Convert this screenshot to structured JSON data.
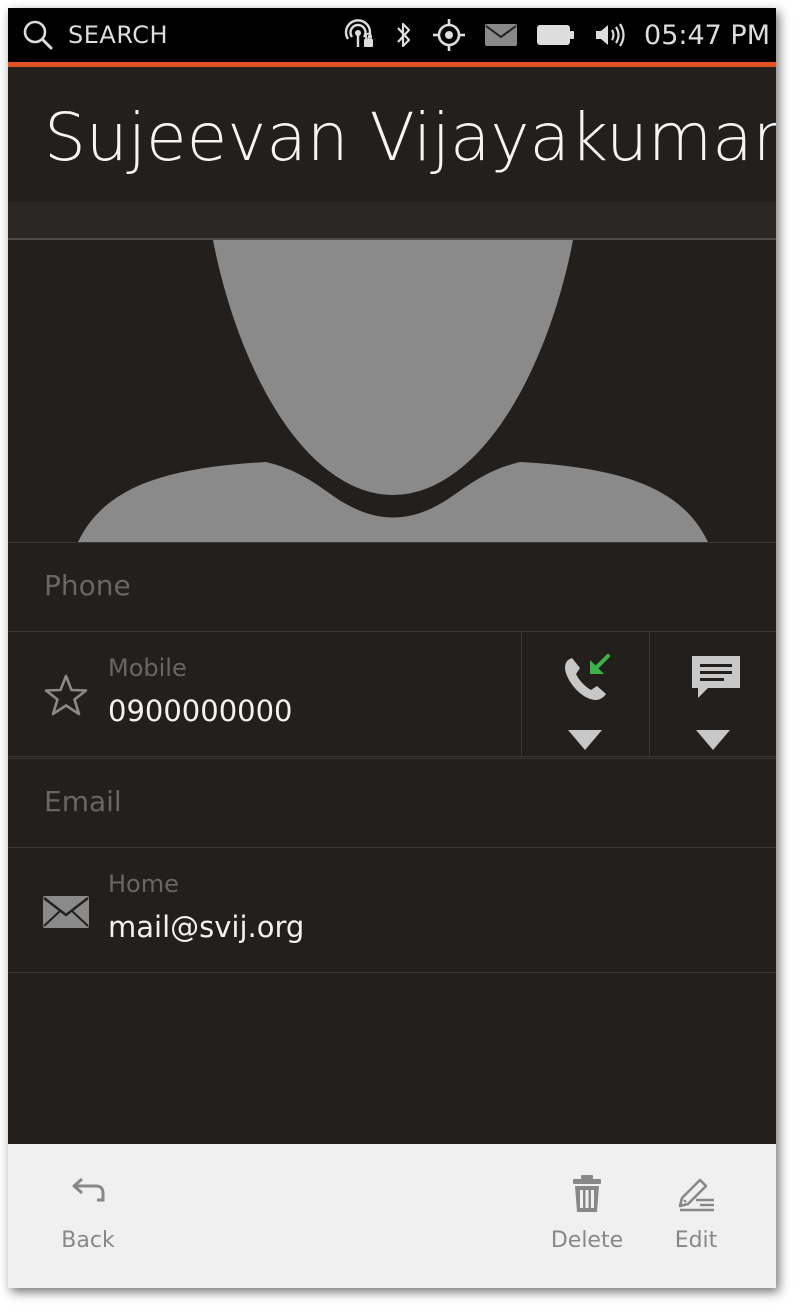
{
  "status_bar": {
    "search_label": "SEARCH",
    "time": "05:47 PM",
    "accent_color": "#e05222",
    "icons": [
      "search-icon",
      "network-icon",
      "bluetooth-icon",
      "location-icon",
      "messages-icon",
      "battery-icon",
      "volume-icon"
    ]
  },
  "header": {
    "title": "Sujeevan Vijayakumara"
  },
  "phone_section": {
    "title": "Phone",
    "entries": [
      {
        "type": "Mobile",
        "value": "0900000000",
        "favorite_icon": "star-icon",
        "call_icon": "call-icon",
        "message_icon": "message-icon"
      }
    ]
  },
  "email_section": {
    "title": "Email",
    "entries": [
      {
        "type": "Home",
        "value": "mail@svij.org",
        "icon": "envelope-icon"
      }
    ]
  },
  "toolbar": {
    "back_label": "Back",
    "delete_label": "Delete",
    "edit_label": "Edit"
  },
  "colors": {
    "background": "#221f1d",
    "toolbar": "#f0f0f0",
    "call_accent": "#3bb54a"
  }
}
